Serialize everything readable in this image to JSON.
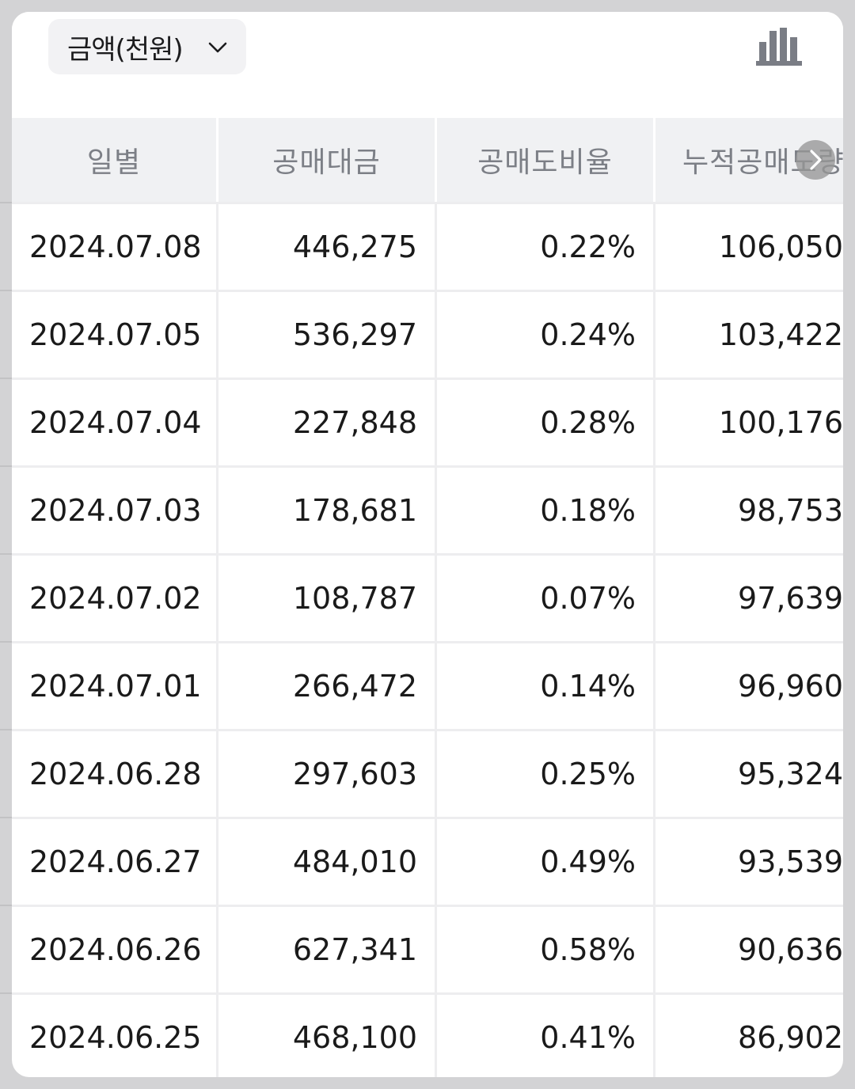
{
  "toolbar": {
    "unit_select_label": "금액(천원)",
    "unit_select_icon": "chevron-down-icon",
    "chart_toggle_icon": "bar-chart-icon"
  },
  "table": {
    "headers": [
      "일별",
      "공매대금",
      "공매도비율",
      "누적공매도량"
    ],
    "scroll_icon": "chevron-right-icon",
    "rows": [
      {
        "date": "2024.07.08",
        "amount": "446,275",
        "ratio": "0.22%",
        "cumulative": "106,050"
      },
      {
        "date": "2024.07.05",
        "amount": "536,297",
        "ratio": "0.24%",
        "cumulative": "103,422"
      },
      {
        "date": "2024.07.04",
        "amount": "227,848",
        "ratio": "0.28%",
        "cumulative": "100,176"
      },
      {
        "date": "2024.07.03",
        "amount": "178,681",
        "ratio": "0.18%",
        "cumulative": "98,753"
      },
      {
        "date": "2024.07.02",
        "amount": "108,787",
        "ratio": "0.07%",
        "cumulative": "97,639"
      },
      {
        "date": "2024.07.01",
        "amount": "266,472",
        "ratio": "0.14%",
        "cumulative": "96,960"
      },
      {
        "date": "2024.06.28",
        "amount": "297,603",
        "ratio": "0.25%",
        "cumulative": "95,324"
      },
      {
        "date": "2024.06.27",
        "amount": "484,010",
        "ratio": "0.49%",
        "cumulative": "93,539"
      },
      {
        "date": "2024.06.26",
        "amount": "627,341",
        "ratio": "0.58%",
        "cumulative": "90,636"
      },
      {
        "date": "2024.06.25",
        "amount": "468,100",
        "ratio": "0.41%",
        "cumulative": "86,902"
      }
    ]
  },
  "colors": {
    "background": "#d3d3d5",
    "card": "#ffffff",
    "header_bg": "#f0f1f3",
    "header_text": "#7c7f86",
    "cell_text": "#1a1a1a",
    "chart_icon": "#7a7d85"
  }
}
